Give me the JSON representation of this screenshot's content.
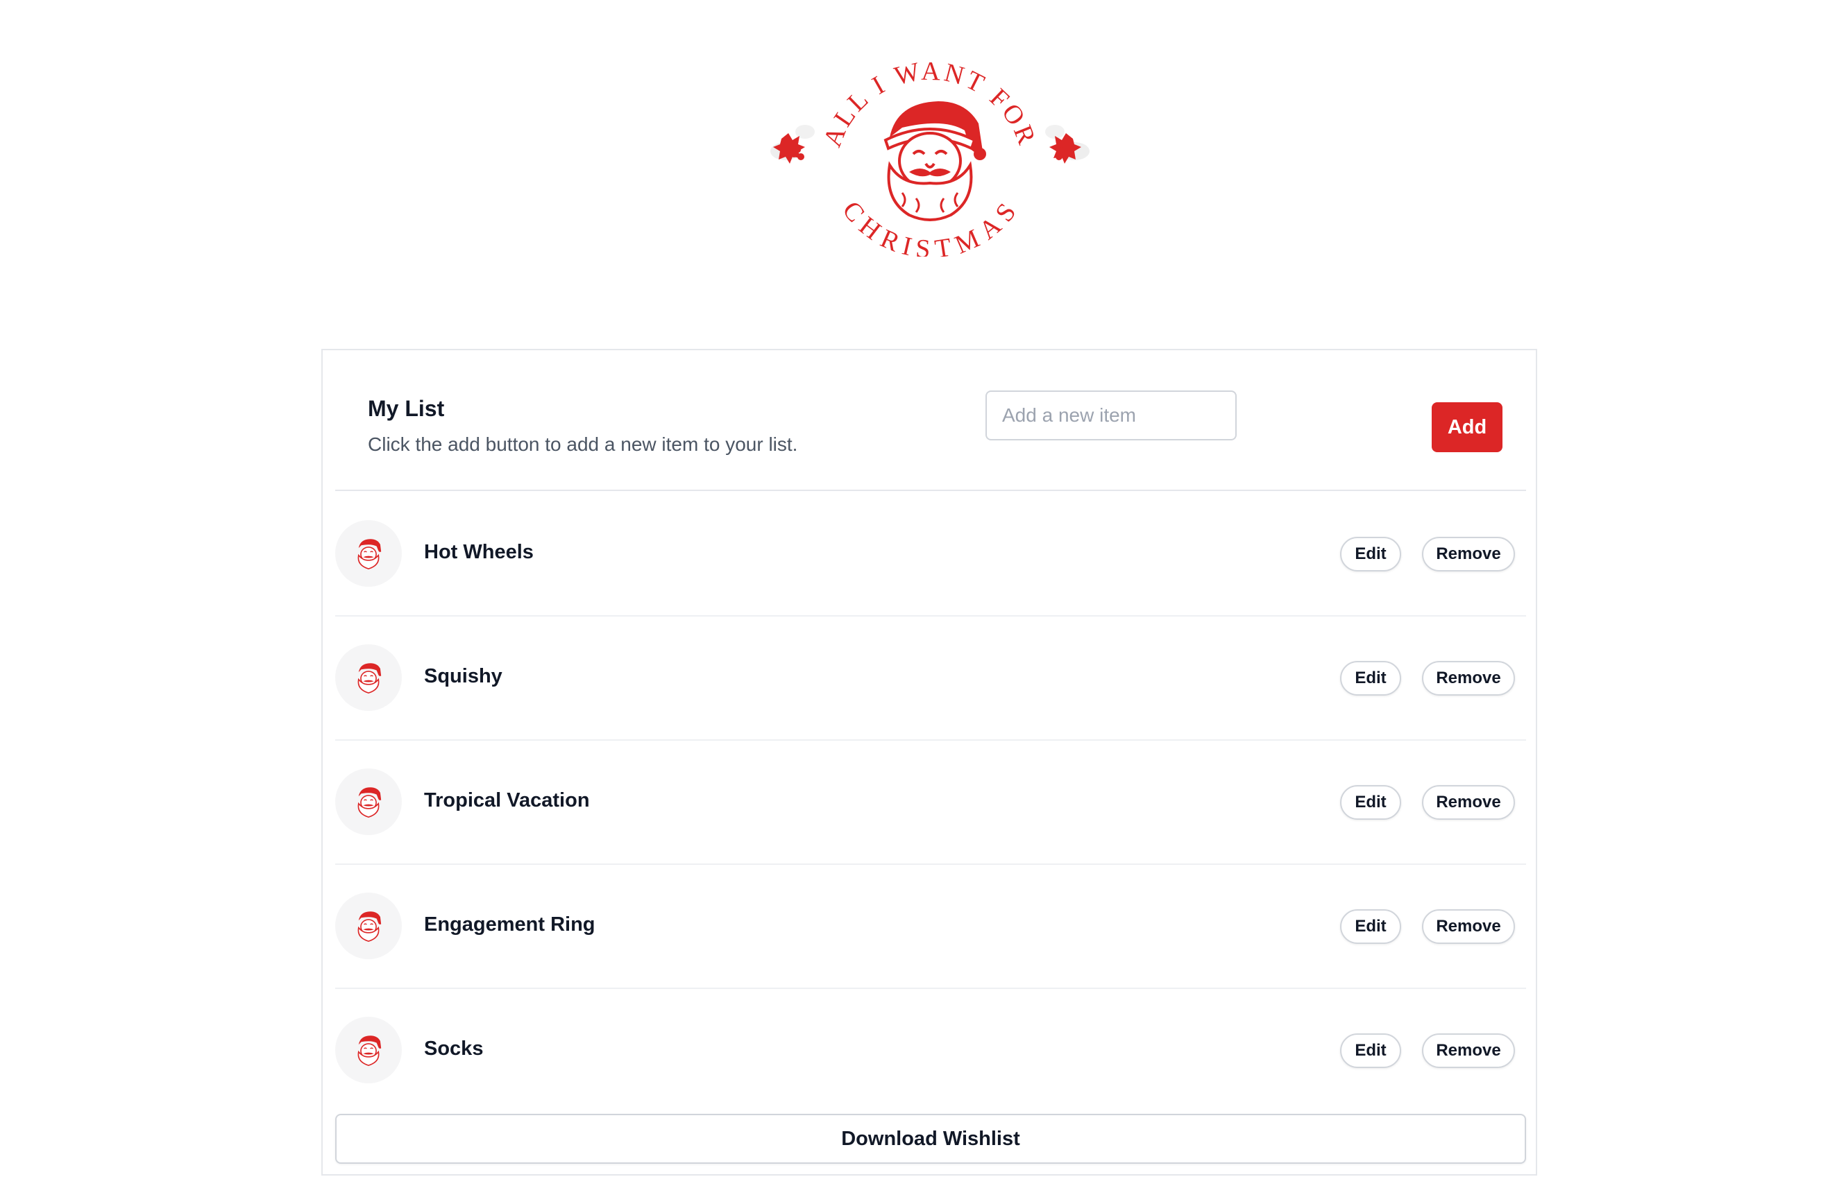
{
  "logo": {
    "text_top": "ALL I WANT FOR",
    "text_bottom": "CHRISTMAS",
    "color": "#dc2626",
    "icon": "santa-icon"
  },
  "header": {
    "title": "My List",
    "subtitle": "Click the add button to add a new item to your list.",
    "input_placeholder": "Add a new item",
    "input_value": "",
    "add_label": "Add"
  },
  "items": [
    {
      "name": "Hot Wheels",
      "edit_label": "Edit",
      "remove_label": "Remove",
      "icon": "santa-icon"
    },
    {
      "name": "Squishy",
      "edit_label": "Edit",
      "remove_label": "Remove",
      "icon": "santa-icon"
    },
    {
      "name": "Tropical Vacation",
      "edit_label": "Edit",
      "remove_label": "Remove",
      "icon": "santa-icon"
    },
    {
      "name": "Engagement Ring",
      "edit_label": "Edit",
      "remove_label": "Remove",
      "icon": "santa-icon"
    },
    {
      "name": "Socks",
      "edit_label": "Edit",
      "remove_label": "Remove",
      "icon": "santa-icon"
    }
  ],
  "footer": {
    "download_label": "Download Wishlist"
  },
  "colors": {
    "accent": "#dc2626",
    "border": "#e5e7eb",
    "text": "#111827",
    "muted": "#4b5563"
  }
}
